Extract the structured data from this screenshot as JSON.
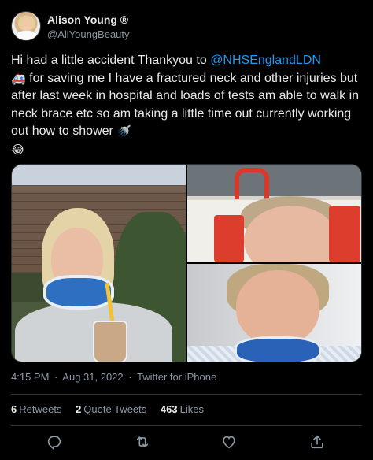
{
  "user": {
    "display_name": "Alison Young ®",
    "handle": "@AliYoungBeauty",
    "avatar_icon": "avatar-photo"
  },
  "tweet": {
    "text_part1": "Hi had a little accident Thankyou to ",
    "mention": "@NHSEnglandLDN",
    "emoji_ambulance": "🚑",
    "text_part2": " for saving me I have a fractured neck and other injuries but after last week in hospital and loads of tests am able to walk in neck brace etc so am taking a little time out currently working out how to shower ",
    "emoji_shower": "🚿",
    "emoji_laugh": "😂"
  },
  "media": {
    "photos": [
      "selfie-neck-brace-outdoors",
      "hospital-bed-head-blocks",
      "hospital-selfie-neck-brace"
    ]
  },
  "meta": {
    "time": "4:15 PM",
    "date": "Aug 31, 2022",
    "separator": "·",
    "source": "Twitter for iPhone"
  },
  "stats": {
    "retweets_count": "6",
    "retweets_label": "Retweets",
    "quotes_count": "2",
    "quotes_label": "Quote Tweets",
    "likes_count": "463",
    "likes_label": "Likes"
  },
  "actions": [
    "reply-icon",
    "retweet-icon",
    "like-icon",
    "share-icon"
  ],
  "colors": {
    "background": "#000000",
    "text": "#e7e9ea",
    "secondary_text": "#8b98a5",
    "link": "#1d9bf0",
    "border": "#2f3336"
  }
}
